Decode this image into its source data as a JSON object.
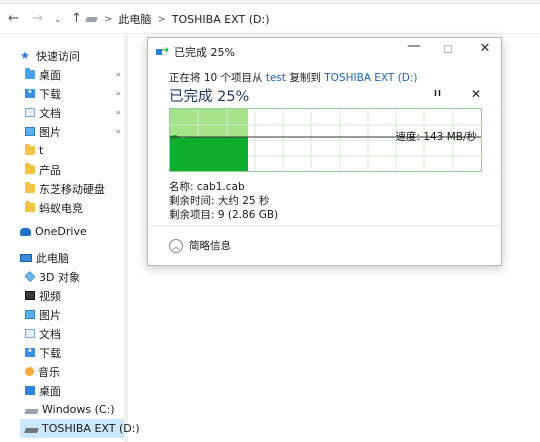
{
  "address_bar": {
    "back_icon": "←",
    "forward_icon": "→",
    "recent_icon": "⌄",
    "up_icon": "↑",
    "sep1": ">",
    "crumb_pc": "此电脑",
    "sep2": ">",
    "crumb_drive": "TOSHIBA EXT (D:)"
  },
  "sidebar": {
    "quick_access": "快速访问",
    "quick_items": [
      {
        "label": "桌面",
        "pinned": true
      },
      {
        "label": "下载",
        "pinned": true
      },
      {
        "label": "文档",
        "pinned": true
      },
      {
        "label": "图片",
        "pinned": true
      },
      {
        "label": "t"
      },
      {
        "label": "产品"
      },
      {
        "label": "东芝移动硬盘"
      },
      {
        "label": "蚂蚁电竞"
      }
    ],
    "onedrive": "OneDrive",
    "this_pc": "此电脑",
    "pc_items": [
      "3D 对象",
      "视频",
      "图片",
      "文档",
      "下载",
      "音乐",
      "桌面",
      "Windows (C:)",
      "TOSHIBA EXT (D:)"
    ],
    "selected_item": "TOSHIBA EXT (D:)"
  },
  "dialog": {
    "title": "已完成 25%",
    "desc_prefix": "正在将 10 个项目从 ",
    "desc_source": "test",
    "desc_mid": " 复制到 ",
    "desc_dest": "TOSHIBA EXT (D:)",
    "percent_heading": "已完成 25%",
    "pause_icon": "II",
    "stop_icon": "✕",
    "speed_label": "速度: 143 MB/秒",
    "progress_percent": 25,
    "name_line": "名称: cab1.cab",
    "time_line": "剩余时间: 大约 25 秒",
    "items_line": "剩余项目: 9 (2.86 GB)",
    "details_toggle": "简略信息",
    "min_icon": "—",
    "close_icon": "✕",
    "colors": {
      "progress_light": "#a6e38a",
      "progress_dark": "#0ead2d",
      "grid": "#d7e7d7",
      "link": "#1a64b5"
    }
  }
}
